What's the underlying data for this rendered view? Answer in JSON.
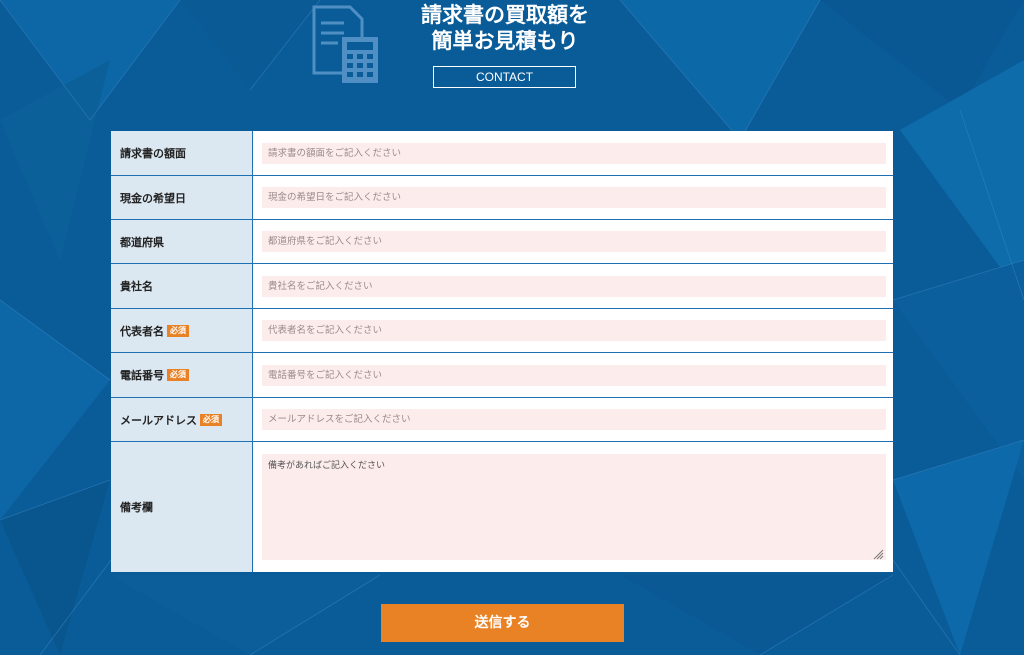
{
  "header": {
    "title_line1": "請求書の買取額を",
    "title_line2": "簡単お見積もり",
    "contact_label": "CONTACT",
    "icon": "calculator-document-icon"
  },
  "form": {
    "required_badge": "必須",
    "fields": [
      {
        "label": "請求書の額面",
        "placeholder": "請求書の額面をご記入ください",
        "required": false
      },
      {
        "label": "現金の希望日",
        "placeholder": "現金の希望日をご記入ください",
        "required": false
      },
      {
        "label": "都道府県",
        "placeholder": "都道府県をご記入ください",
        "required": false
      },
      {
        "label": "貴社名",
        "placeholder": "貴社名をご記入ください",
        "required": false
      },
      {
        "label": "代表者名",
        "placeholder": "代表者名をご記入ください",
        "required": true
      },
      {
        "label": "電話番号",
        "placeholder": "電話番号をご記入ください",
        "required": true
      },
      {
        "label": "メールアドレス",
        "placeholder": "メールアドレスをご記入ください",
        "required": true
      },
      {
        "label": "備考欄",
        "placeholder": "備考があればご記入ください",
        "required": false
      }
    ],
    "submit_label": "送信する"
  },
  "colors": {
    "background": "#0a5c99",
    "label_cell": "#dbe7f1",
    "input_bg": "#fdecec",
    "accent": "#e98125",
    "border": "#1f6fb3"
  }
}
